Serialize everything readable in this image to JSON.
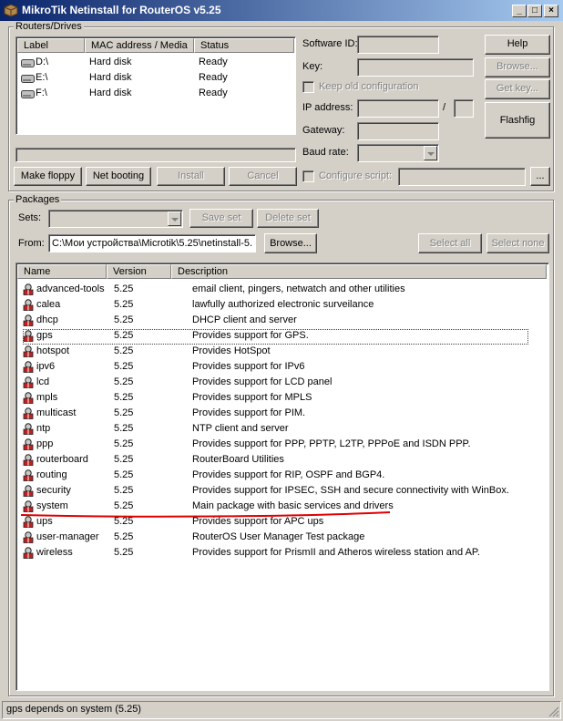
{
  "window": {
    "title": "MikroTik Netinstall for RouterOS v5.25"
  },
  "routers": {
    "group_label": "Routers/Drives",
    "columns": [
      "Label",
      "MAC address / Media",
      "Status"
    ],
    "rows": [
      {
        "label": "D:\\",
        "media": "Hard disk",
        "status": "Ready"
      },
      {
        "label": "E:\\",
        "media": "Hard disk",
        "status": "Ready"
      },
      {
        "label": "F:\\",
        "media": "Hard disk",
        "status": "Ready"
      }
    ]
  },
  "form": {
    "software_id": "Software ID:",
    "key": "Key:",
    "keep_old": "Keep old configuration",
    "ip_address": "IP address:",
    "ip_sep": "/",
    "gateway": "Gateway:",
    "baud_rate": "Baud rate:",
    "configure_script": "Configure script:",
    "browse_script": "..."
  },
  "buttons": {
    "help": "Help",
    "browse_key": "Browse...",
    "get_key": "Get key...",
    "flashfig": "Flashfig",
    "make_floppy": "Make floppy",
    "net_booting": "Net booting",
    "install": "Install",
    "cancel": "Cancel"
  },
  "packages": {
    "group_label": "Packages",
    "sets_label": "Sets:",
    "save_set": "Save set",
    "delete_set": "Delete set",
    "from_label": "From:",
    "from_path": "C:\\Мои устройства\\Microtik\\5.25\\netinstall-5.",
    "browse": "Browse...",
    "select_all": "Select all",
    "select_none": "Select none",
    "columns": [
      "Name",
      "Version",
      "Description"
    ],
    "items": [
      {
        "name": "advanced-tools",
        "version": "5.25",
        "desc": "email client, pingers, netwatch and other utilities"
      },
      {
        "name": "calea",
        "version": "5.25",
        "desc": "lawfully authorized electronic surveilance"
      },
      {
        "name": "dhcp",
        "version": "5.25",
        "desc": "DHCP client and server"
      },
      {
        "name": "gps",
        "version": "5.25",
        "desc": "Provides support for GPS."
      },
      {
        "name": "hotspot",
        "version": "5.25",
        "desc": "Provides HotSpot"
      },
      {
        "name": "ipv6",
        "version": "5.25",
        "desc": "Provides support for IPv6"
      },
      {
        "name": "lcd",
        "version": "5.25",
        "desc": "Provides support for LCD panel"
      },
      {
        "name": "mpls",
        "version": "5.25",
        "desc": "Provides support for MPLS"
      },
      {
        "name": "multicast",
        "version": "5.25",
        "desc": "Provides support for PIM."
      },
      {
        "name": "ntp",
        "version": "5.25",
        "desc": "NTP client and server"
      },
      {
        "name": "ppp",
        "version": "5.25",
        "desc": "Provides support for PPP, PPTP, L2TP, PPPoE and ISDN PPP."
      },
      {
        "name": "routerboard",
        "version": "5.25",
        "desc": "RouterBoard Utilities"
      },
      {
        "name": "routing",
        "version": "5.25",
        "desc": "Provides support for RIP, OSPF and BGP4."
      },
      {
        "name": "security",
        "version": "5.25",
        "desc": "Provides support for IPSEC, SSH and secure connectivity with WinBox."
      },
      {
        "name": "system",
        "version": "5.25",
        "desc": "Main package with basic services and drivers"
      },
      {
        "name": "ups",
        "version": "5.25",
        "desc": "Provides support for APC ups"
      },
      {
        "name": "user-manager",
        "version": "5.25",
        "desc": "RouterOS User Manager Test package"
      },
      {
        "name": "wireless",
        "version": "5.25",
        "desc": "Provides support for PrismII and Atheros wireless station and AP."
      }
    ]
  },
  "status_bar": {
    "text": "gps depends on system (5.25)"
  },
  "icons": {
    "app": "mikrotik-box-icon",
    "disk": "hard-disk-icon",
    "package": "package-icon"
  },
  "colors": {
    "title_start": "#0a246a",
    "title_end": "#a6caf0",
    "annotation": "#e00000",
    "face": "#d4d0c8"
  }
}
